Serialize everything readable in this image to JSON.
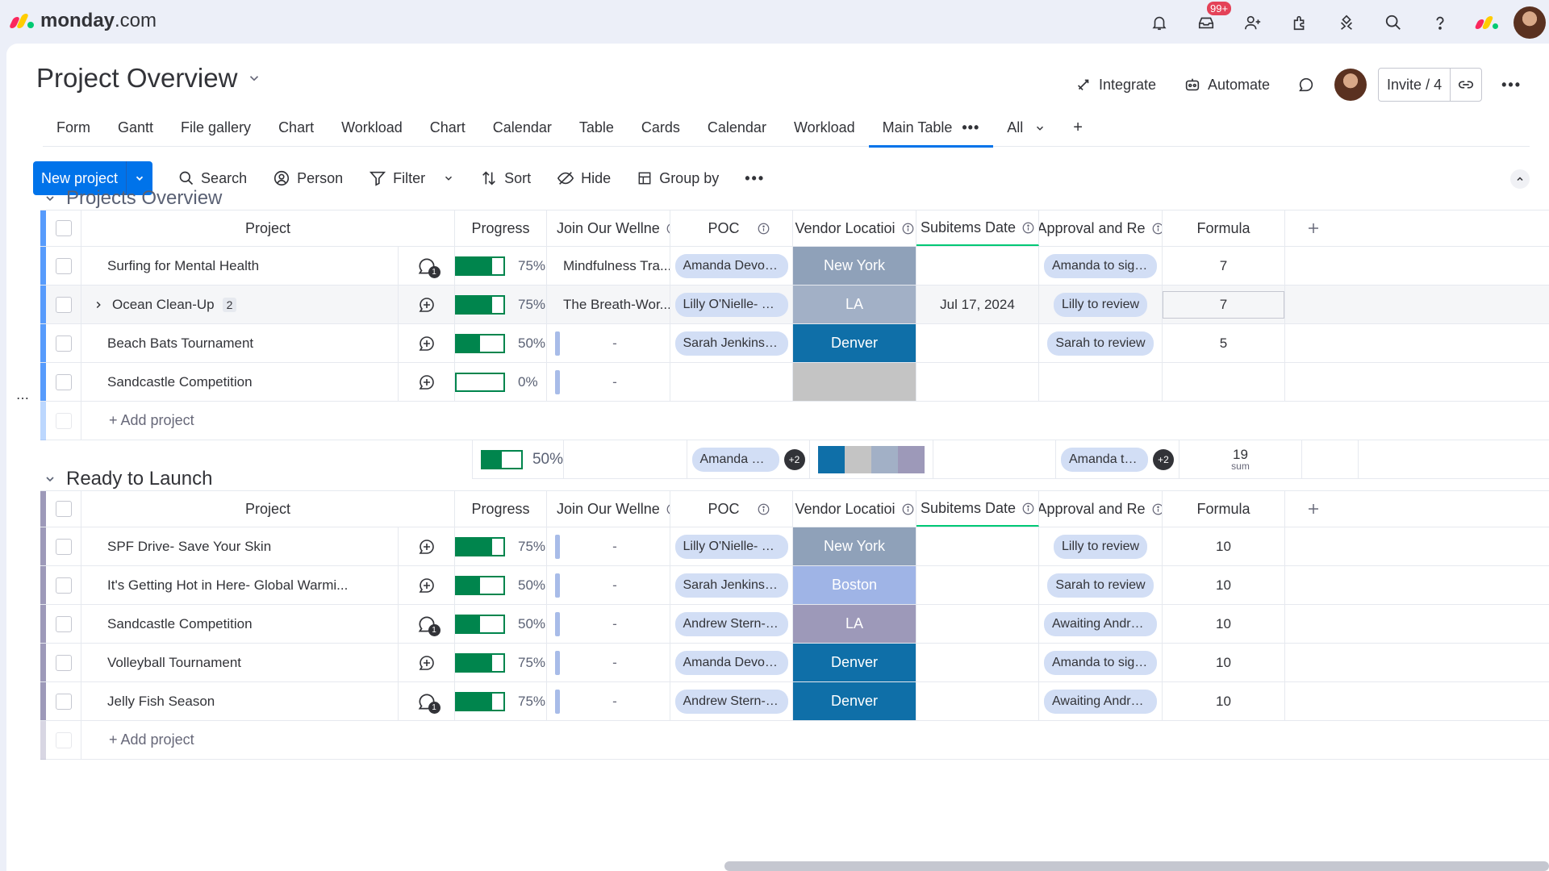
{
  "brand": {
    "name_bold": "monday",
    "name_suffix": ".com",
    "colors": [
      "#fb275d",
      "#ffcc00",
      "#00ca72"
    ]
  },
  "topbar": {
    "notifications_badge": "99+"
  },
  "header": {
    "title": "Project Overview",
    "integrate": "Integrate",
    "automate": "Automate",
    "invite": "Invite / 4"
  },
  "tabs": [
    "Form",
    "Gantt",
    "File gallery",
    "Chart",
    "Workload",
    "Chart",
    "Calendar",
    "Table",
    "Cards",
    "Calendar",
    "Workload",
    "Main Table"
  ],
  "tabs_extra": {
    "all": "All",
    "add": "+"
  },
  "toolbar": {
    "new_project": "New project",
    "search": "Search",
    "person": "Person",
    "filter": "Filter",
    "sort": "Sort",
    "hide": "Hide",
    "group_by": "Group by"
  },
  "columns": {
    "project": "Project",
    "progress": "Progress",
    "join": "Join Our Wellne",
    "poc": "POC",
    "vendor": "Vendor Locatioi",
    "subitems_date": "Subitems Date",
    "approval": "Approval and Re",
    "formula": "Formula"
  },
  "groups": [
    {
      "title": "Projects Overview",
      "color": "#579bfc",
      "rows": [
        {
          "name": "Surfing for Mental Health",
          "update_badge": "1",
          "progress": 75,
          "progress_label": "75%",
          "join": "Mindfulness Tra...",
          "poc": "Amanda Devons- ...",
          "vendor": "New York",
          "vendor_color": "#8fa1b9",
          "sub_date": "",
          "approval": "Amanda to sign off",
          "formula": "7"
        },
        {
          "name": "Ocean Clean-Up",
          "subitems": "2",
          "progress": 75,
          "progress_label": "75%",
          "join": "The Breath-Wor...",
          "poc": "Lilly O'Nielle- HR",
          "vendor": "LA",
          "vendor_color": "#a2b0c6",
          "sub_date": "Jul 17, 2024",
          "approval": "Lilly to review",
          "formula": "7"
        },
        {
          "name": "Beach Bats Tournament",
          "progress": 50,
          "progress_label": "50%",
          "join": "-",
          "poc": "Sarah Jenkins- M...",
          "vendor": "Denver",
          "vendor_color": "#0f6fa8",
          "sub_date": "",
          "approval": "Sarah to review",
          "formula": "5"
        },
        {
          "name": "Sandcastle Competition",
          "progress": 0,
          "progress_label": "0%",
          "join": "-",
          "poc": "",
          "vendor": "",
          "vendor_color": "#c4c4c4",
          "sub_date": "",
          "approval": "",
          "formula": ""
        }
      ],
      "add_label": "+ Add project",
      "summary": {
        "progress": 50,
        "progress_label": "50%",
        "poc": "Amanda Devo...",
        "poc_more": "+2",
        "approval": "Amanda to sig...",
        "approval_more": "+2",
        "formula": "19",
        "formula_label": "sum",
        "vendor_segments": [
          "#0f6fa8",
          "#c4c4c4",
          "#a2b0c6",
          "#9d99b9"
        ]
      }
    },
    {
      "title": "Ready to Launch",
      "color": "#9d99b9",
      "rows": [
        {
          "name": "SPF Drive- Save Your Skin",
          "progress": 75,
          "progress_label": "75%",
          "join": "-",
          "poc": "Lilly O'Nielle- HR",
          "vendor": "New York",
          "vendor_color": "#8fa1b9",
          "sub_date": "",
          "approval": "Lilly to review",
          "formula": "10"
        },
        {
          "name": "It's Getting Hot in Here- Global Warmi...",
          "progress": 50,
          "progress_label": "50%",
          "join": "-",
          "poc": "Sarah Jenkins- M...",
          "vendor": "Boston",
          "vendor_color": "#9fb4e6",
          "sub_date": "",
          "approval": "Sarah to review",
          "formula": "10"
        },
        {
          "name": "Sandcastle Competition",
          "update_badge": "1",
          "progress": 50,
          "progress_label": "50%",
          "join": "-",
          "poc": "Andrew Stern- Fi...",
          "vendor": "LA",
          "vendor_color": "#9d99b9",
          "sub_date": "",
          "approval": "Awaiting Andrew'...",
          "formula": "10"
        },
        {
          "name": "Volleyball Tournament",
          "progress": 75,
          "progress_label": "75%",
          "join": "-",
          "poc": "Amanda Devons- ...",
          "vendor": "Denver",
          "vendor_color": "#0f6fa8",
          "sub_date": "",
          "approval": "Amanda to sign off",
          "formula": "10"
        },
        {
          "name": "Jelly Fish Season",
          "update_badge": "1",
          "progress": 75,
          "progress_label": "75%",
          "join": "-",
          "poc": "Andrew Stern- Fi...",
          "vendor": "Denver",
          "vendor_color": "#0f6fa8",
          "sub_date": "",
          "approval": "Awaiting Andrew'...",
          "formula": "10"
        }
      ],
      "add_label": "+ Add project"
    }
  ],
  "icons": [
    "bell-icon",
    "inbox-icon",
    "invite-member-icon",
    "apps-icon",
    "marketplace-icon",
    "search-icon",
    "help-icon",
    "avatar"
  ]
}
